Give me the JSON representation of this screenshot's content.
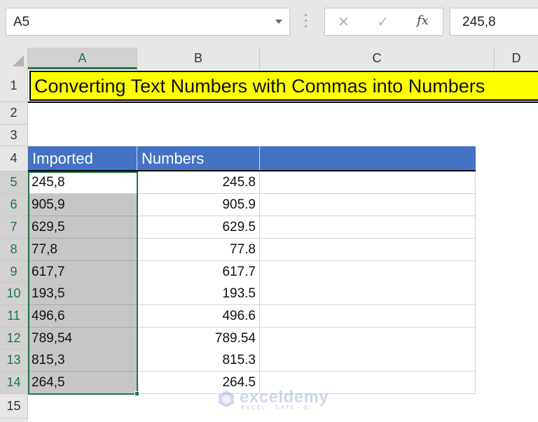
{
  "formula_bar": {
    "name_box": "A5",
    "cancel_icon": "✕",
    "enter_icon": "✓",
    "fx_label": "fx",
    "formula_value": "245,8"
  },
  "columns": [
    "A",
    "B",
    "C",
    "D"
  ],
  "selected_column": "A",
  "rows": [
    "1",
    "2",
    "3",
    "4",
    "5",
    "6",
    "7",
    "8",
    "9",
    "10",
    "11",
    "12",
    "13",
    "14",
    "15"
  ],
  "sheet": {
    "title": "Converting Text Numbers with Commas into Numbers",
    "table": {
      "headers": [
        "Imported",
        "Numbers",
        ""
      ],
      "rows": [
        {
          "imported": "245,8",
          "number": "245.8"
        },
        {
          "imported": "905,9",
          "number": "905.9"
        },
        {
          "imported": "629,5",
          "number": "629.5"
        },
        {
          "imported": "77,8",
          "number": "77.8"
        },
        {
          "imported": "617,7",
          "number": "617.7"
        },
        {
          "imported": "193,5",
          "number": "193.5"
        },
        {
          "imported": "496,6",
          "number": "496.6"
        },
        {
          "imported": "789,54",
          "number": "789.54"
        },
        {
          "imported": "815,3",
          "number": "815.3"
        },
        {
          "imported": "264,5",
          "number": "264.5"
        }
      ]
    }
  },
  "watermark": {
    "brand": "exceldemy",
    "tagline": "EXCEL · DATA · BI"
  },
  "colors": {
    "title_fill": "#ffff00",
    "header_fill": "#4472c4",
    "selection": "#217346",
    "selected_range_fill": "#c6c6c6"
  }
}
